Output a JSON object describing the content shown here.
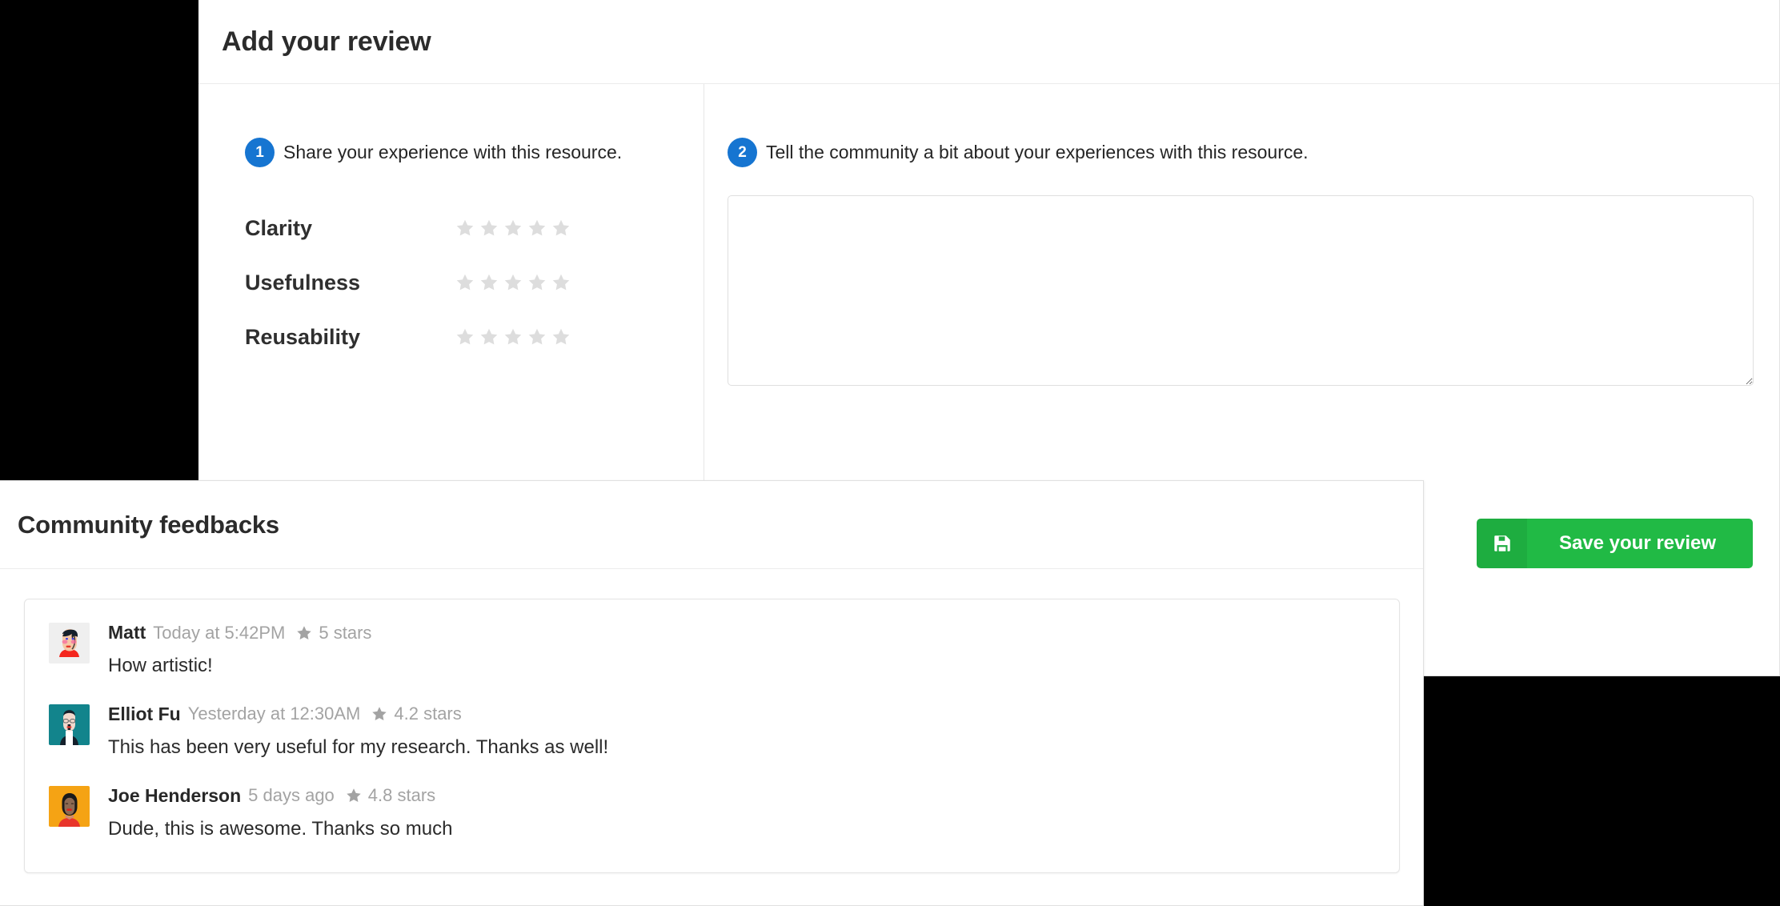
{
  "review_panel": {
    "title": "Add your review",
    "step1": {
      "number": "1",
      "text": "Share your experience with this resource."
    },
    "step2": {
      "number": "2",
      "text": "Tell the community a bit about your experiences with this resource."
    },
    "ratings": [
      {
        "label": "Clarity",
        "value": 0,
        "max": 5
      },
      {
        "label": "Usefulness",
        "value": 0,
        "max": 5
      },
      {
        "label": "Reusability",
        "value": 0,
        "max": 5
      }
    ],
    "textarea": {
      "value": "",
      "placeholder": ""
    },
    "save_button": {
      "label": "Save your review",
      "icon": "save-floppy-icon",
      "color": "#21ba45"
    }
  },
  "community": {
    "title": "Community feedbacks",
    "items": [
      {
        "author": "Matt",
        "time": "Today at 5:42PM",
        "rating": "5 stars",
        "text": "How artistic!",
        "avatar": "matt-avatar"
      },
      {
        "author": "Elliot Fu",
        "time": "Yesterday at 12:30AM",
        "rating": "4.2 stars",
        "text": "This has been very useful for my research. Thanks as well!",
        "avatar": "elliot-fu-avatar"
      },
      {
        "author": "Joe Henderson",
        "time": "5 days ago",
        "rating": "4.8 stars",
        "text": "Dude, this is awesome. Thanks so much",
        "avatar": "joe-henderson-avatar"
      }
    ]
  },
  "theme": {
    "accent_blue": "#1675d1",
    "success_green": "#21ba45",
    "star_empty": "#dddddd",
    "star_filled_meta": "#a3a3a3"
  }
}
